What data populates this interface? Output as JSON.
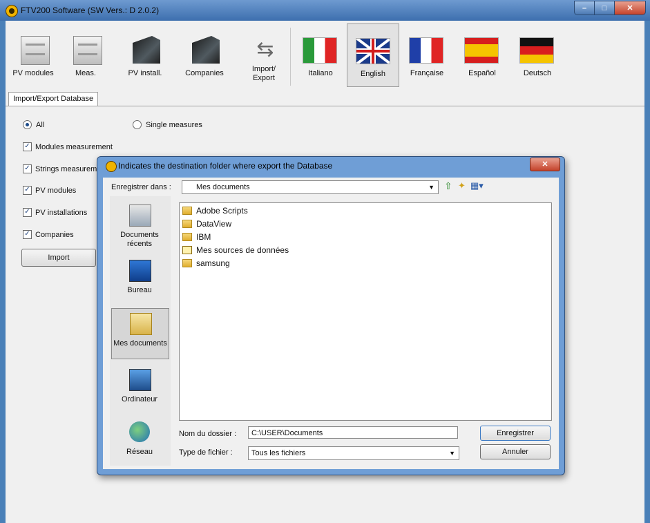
{
  "window": {
    "title": "FTV200 Software (SW Vers.: D 2.0.2)",
    "buttons": {
      "minimize": "–",
      "maximize": "□",
      "close": "✕"
    }
  },
  "toolbar": {
    "items": [
      {
        "label": "PV modules",
        "icon": "cabinet-icon"
      },
      {
        "label": "Meas.",
        "icon": "cabinet-icon"
      },
      {
        "label": "PV install.",
        "icon": "folder-icon"
      },
      {
        "label": "Companies",
        "icon": "folder-icon"
      },
      {
        "label": "Import/\nExport",
        "icon": "usb-icon"
      },
      {
        "label": "Italiano",
        "icon": "italy-flag-icon"
      },
      {
        "label": "English",
        "icon": "uk-flag-icon"
      },
      {
        "label": "Française",
        "icon": "france-flag-icon"
      },
      {
        "label": "Español",
        "icon": "spain-flag-icon"
      },
      {
        "label": "Deutsch",
        "icon": "germany-flag-icon"
      }
    ],
    "import_line1": "Import/",
    "import_line2": "Export"
  },
  "tab": {
    "label": "Import/Export Database"
  },
  "options": {
    "all": "All",
    "single": "Single measures",
    "checks": [
      "Modules measurement",
      "Strings measurem",
      "PV modules",
      "PV installations",
      "Companies"
    ],
    "import_button": "Import"
  },
  "dialog": {
    "title": "Indicates the destination folder where export the Database",
    "close": "✕",
    "save_in_label": "Enregistrer dans :",
    "save_in_value": "Mes documents",
    "places": [
      "Documents récents",
      "Bureau",
      "Mes documents",
      "Ordinateur",
      "Réseau"
    ],
    "files": [
      {
        "name": "Adobe Scripts",
        "icon": "folder-icon"
      },
      {
        "name": "DataView",
        "icon": "folder-icon"
      },
      {
        "name": "IBM",
        "icon": "folder-icon"
      },
      {
        "name": "Mes sources de données",
        "icon": "database-folder-icon"
      },
      {
        "name": "samsung",
        "icon": "folder-icon"
      }
    ],
    "folder_name_label": "Nom du dossier :",
    "folder_name_value": "C:\\USER\\Documents",
    "file_type_label": "Type de fichier :",
    "file_type_value": "Tous les fichiers",
    "save_button": "Enregistrer",
    "cancel_button": "Annuler"
  },
  "colors": {
    "titlebar": "#4a80b8",
    "dialog_frame": "#6f9ed6",
    "close_red": "#c4422a"
  }
}
